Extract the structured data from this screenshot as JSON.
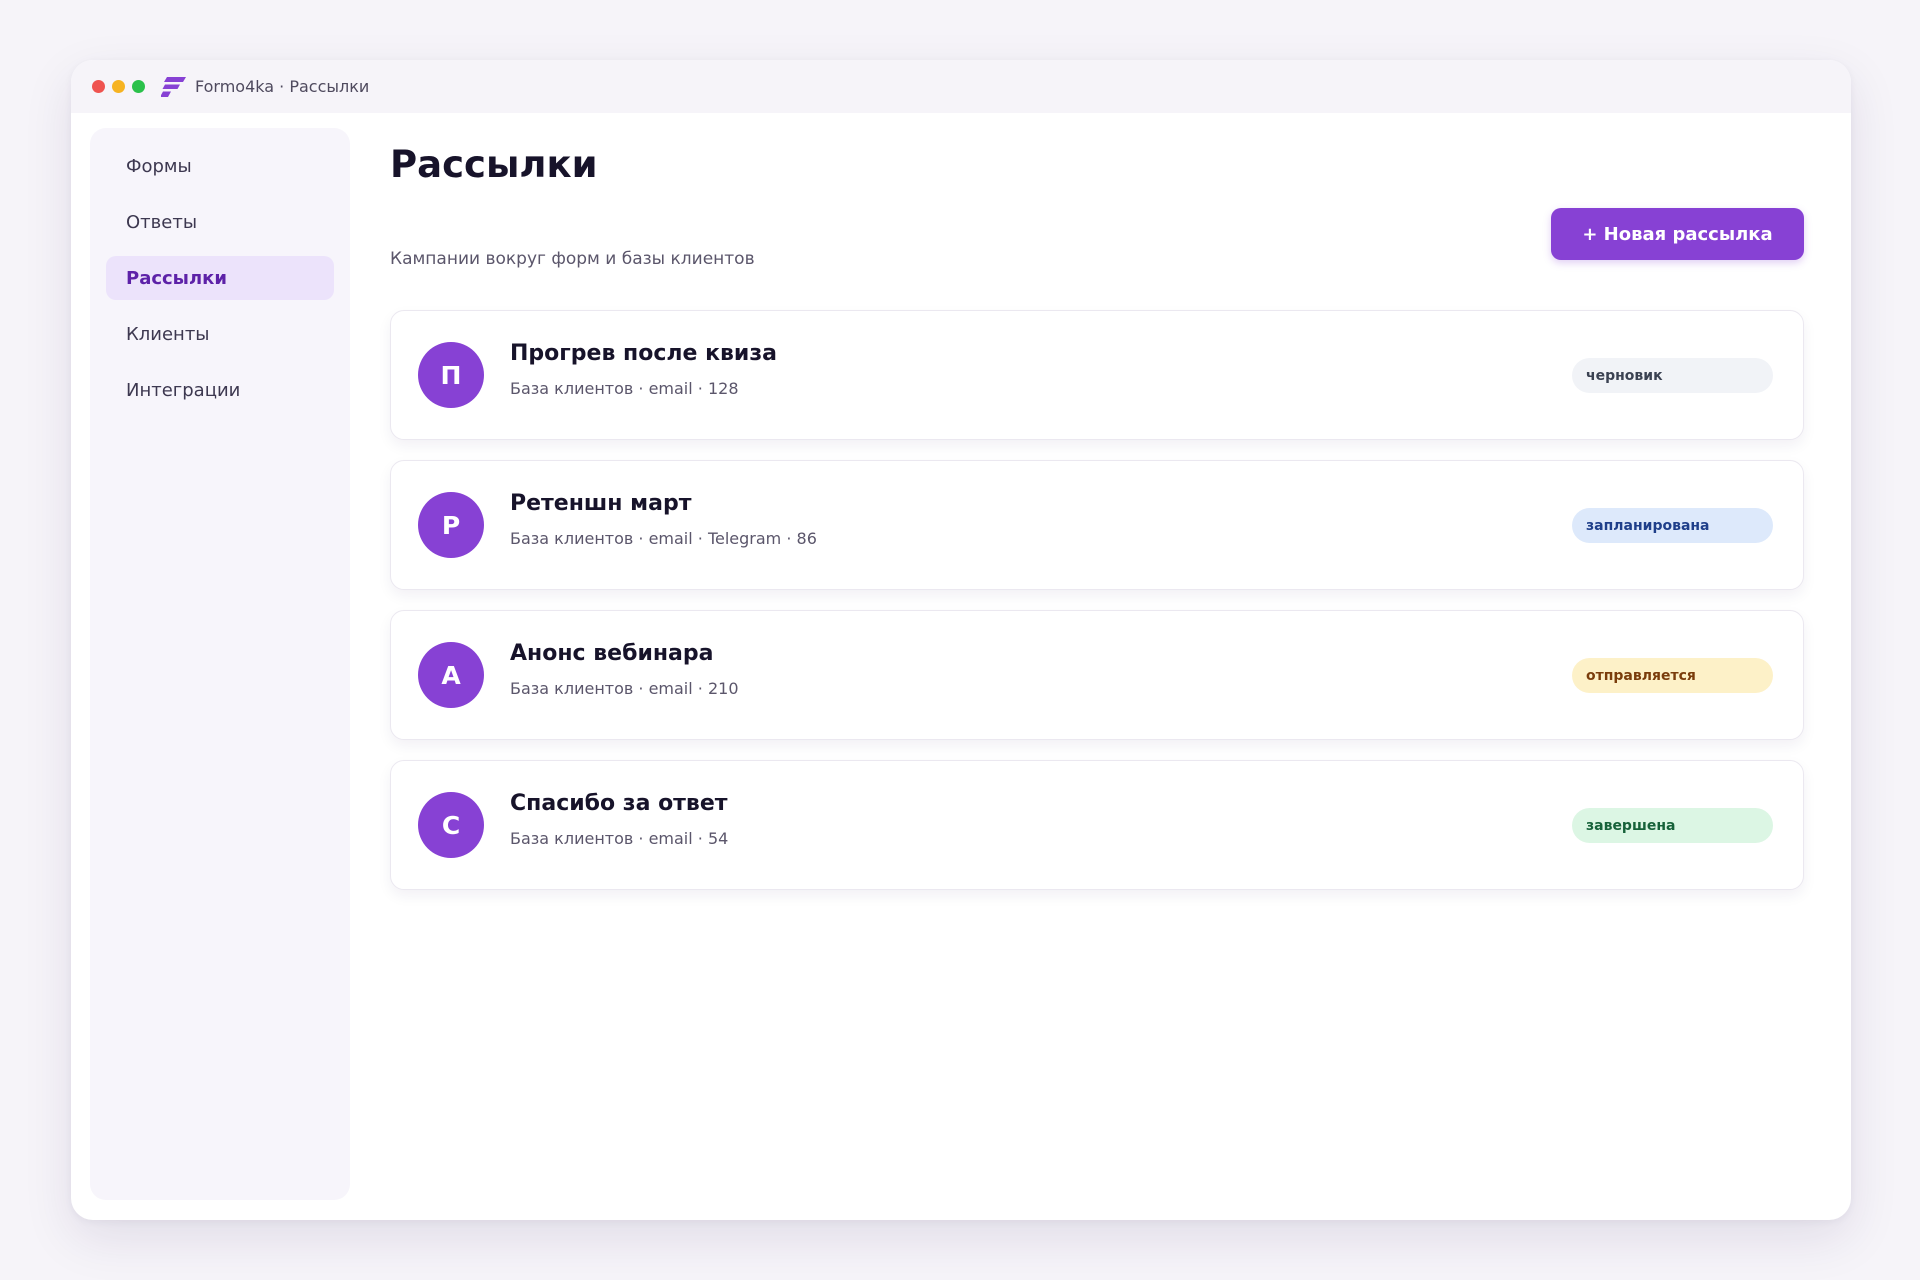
{
  "window": {
    "title": "Formo4ka · Рассылки",
    "logo_icon": "formo4ka-logo-icon"
  },
  "sidebar": {
    "items": [
      {
        "label": "Формы",
        "active": false
      },
      {
        "label": "Ответы",
        "active": false
      },
      {
        "label": "Рассылки",
        "active": true
      },
      {
        "label": "Клиенты",
        "active": false
      },
      {
        "label": "Интеграции",
        "active": false
      }
    ]
  },
  "header": {
    "title": "Рассылки",
    "subtitle": "Кампании вокруг форм и базы клиентов",
    "new_button_label": "+ Новая рассылка"
  },
  "campaigns": [
    {
      "initial": "П",
      "title": "Прогрев после квиза",
      "meta": "База клиентов · email · 128",
      "status": "черновик",
      "status_bg": "#f1f3f7",
      "status_color": "#3b4252"
    },
    {
      "initial": "Р",
      "title": "Ретеншн март",
      "meta": "База клиентов · email · Telegram · 86",
      "status": "запланирована",
      "status_bg": "#dde9fb",
      "status_color": "#1f3f8a"
    },
    {
      "initial": "А",
      "title": "Анонс вебинара",
      "meta": "База клиентов · email · 210",
      "status": "отправляется",
      "status_bg": "#fdf1c8",
      "status_color": "#7a3d0c"
    },
    {
      "initial": "С",
      "title": "Спасибо за ответ",
      "meta": "База клиентов · email · 54",
      "status": "завершена",
      "status_bg": "#dcf6e4",
      "status_color": "#17623a"
    }
  ],
  "colors": {
    "accent": "#8741d4",
    "active_nav_bg": "#ece3fb",
    "active_nav_text": "#5d22a8",
    "window_dots": [
      "#ef5350",
      "#f6b322",
      "#2bc14b"
    ]
  }
}
